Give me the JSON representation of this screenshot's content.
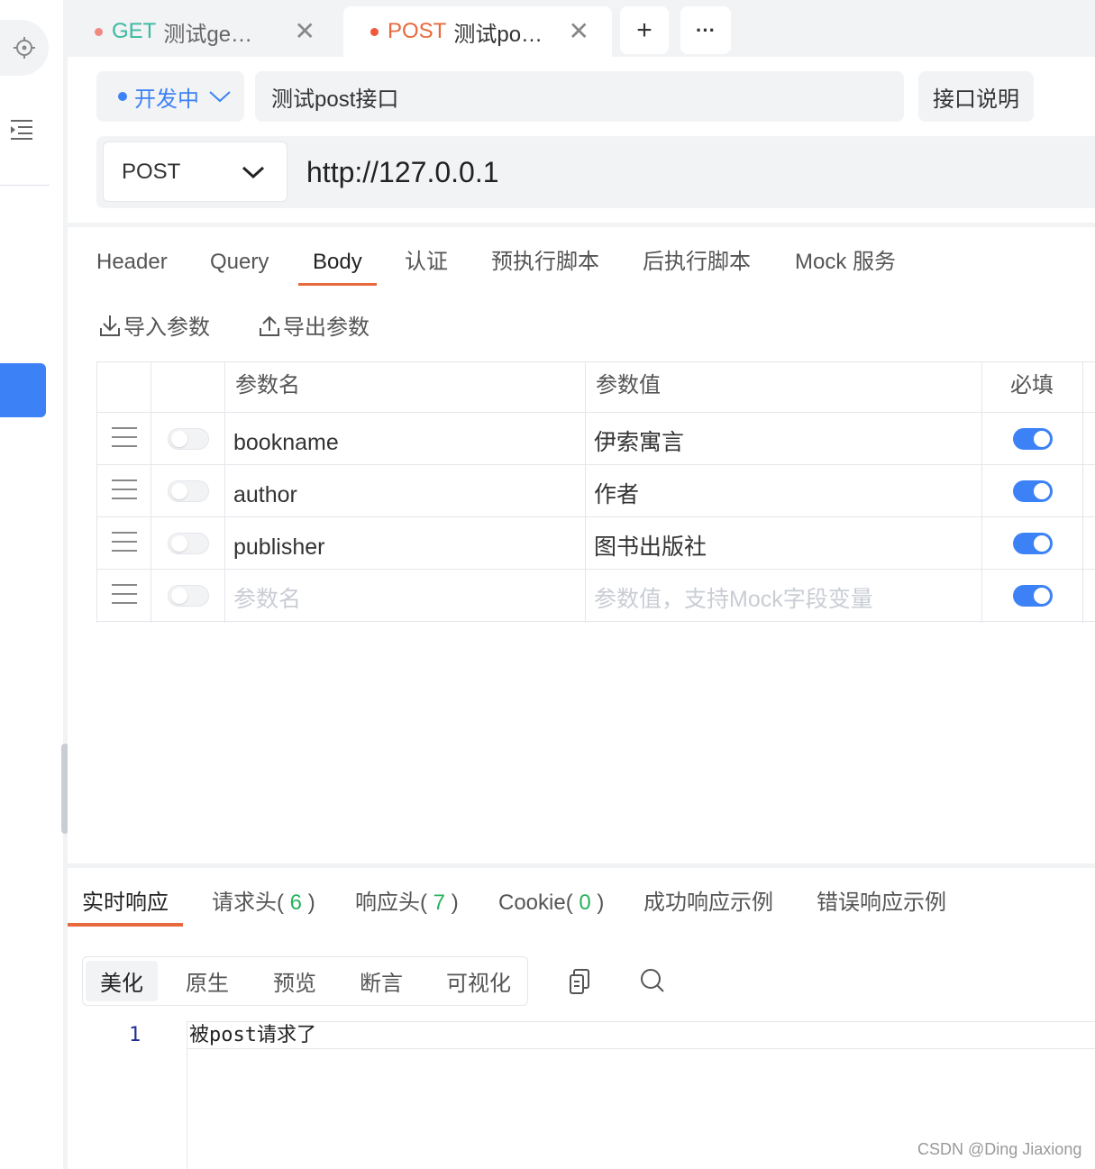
{
  "tabs": [
    {
      "method": "GET",
      "title": "测试get…",
      "method_color": "#3cbaa0",
      "dot_color": "#f08a80"
    },
    {
      "method": "POST",
      "title": "测试post…",
      "method_color": "#e8693c",
      "dot_color": "#f0583c"
    }
  ],
  "tab_actions": {
    "add_symbol": "+",
    "more_symbol": "···"
  },
  "request": {
    "status": "开发中",
    "name": "测试post接口",
    "doc_button": "接口说明",
    "method": "POST",
    "url": "http://127.0.0.1"
  },
  "param_tabs": [
    "Header",
    "Query",
    "Body",
    "认证",
    "预执行脚本",
    "后执行脚本",
    "Mock 服务"
  ],
  "active_param_tab": "Body",
  "actions": {
    "import": "导入参数",
    "export": "导出参数"
  },
  "table": {
    "headers": {
      "name": "参数名",
      "value": "参数值",
      "required": "必填"
    },
    "rows": [
      {
        "name": "bookname",
        "value": "伊索寓言",
        "enabled": false,
        "required": true
      },
      {
        "name": "author",
        "value": "作者",
        "enabled": false,
        "required": true
      },
      {
        "name": "publisher",
        "value": "图书出版社",
        "enabled": false,
        "required": true
      }
    ],
    "placeholder": {
      "name": "参数名",
      "value": "参数值，支持Mock字段变量"
    }
  },
  "response": {
    "tabs": [
      {
        "label": "实时响应"
      },
      {
        "label": "请求头(",
        "count": "6",
        "suffix": ")"
      },
      {
        "label": "响应头(",
        "count": "7",
        "suffix": ")"
      },
      {
        "label": "Cookie(",
        "count": "0",
        "suffix": ")"
      },
      {
        "label": "成功响应示例"
      },
      {
        "label": "错误响应示例"
      }
    ],
    "view_modes": [
      "美化",
      "原生",
      "预览",
      "断言",
      "可视化"
    ],
    "active_view": "美化",
    "line_number": "1",
    "body": "被post请求了"
  },
  "watermark": "CSDN @Ding Jiaxiong",
  "colors": {
    "accent": "#3c82f6",
    "tab_underline": "#e8693c",
    "count_green": "#26b15c"
  }
}
